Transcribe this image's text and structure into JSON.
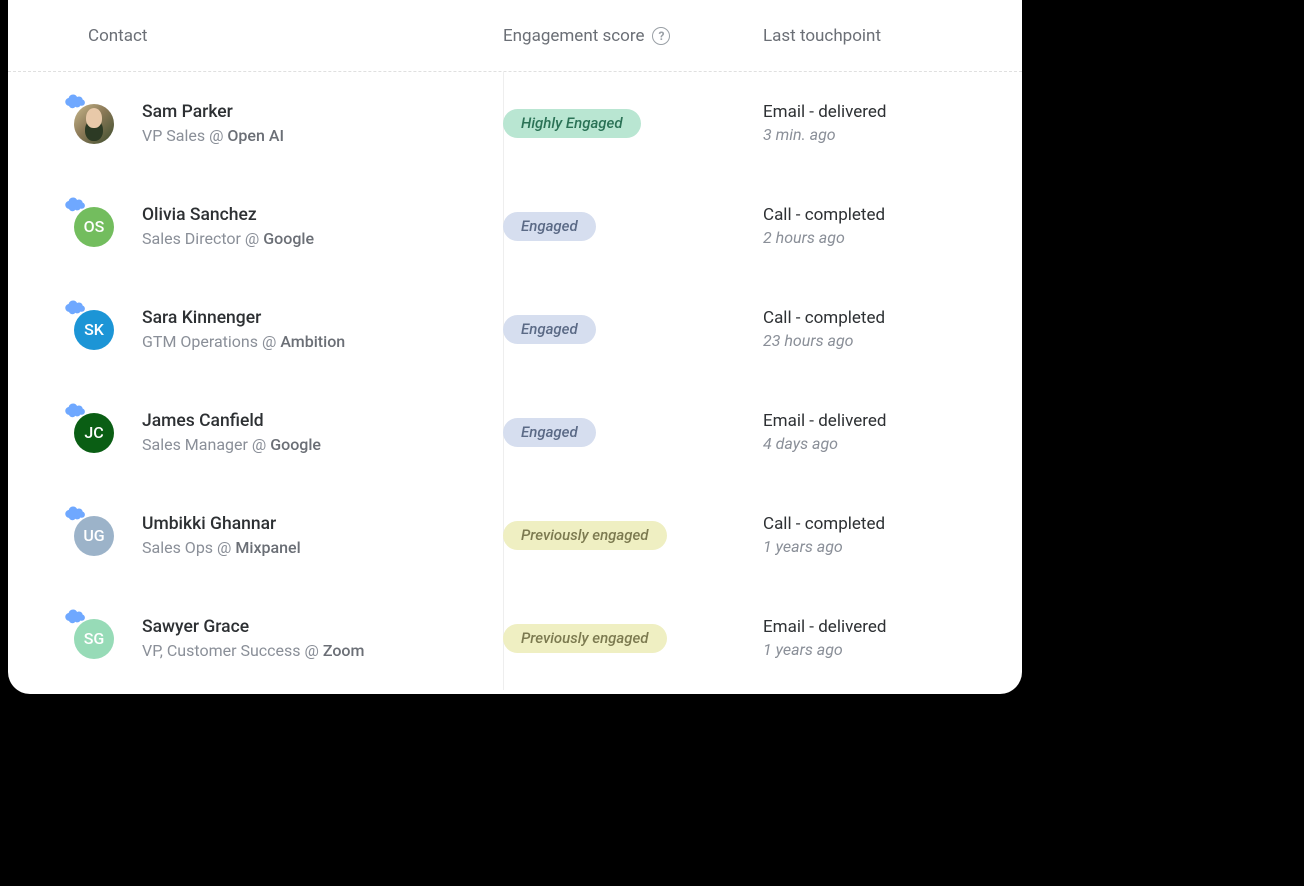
{
  "columns": {
    "contact": "Contact",
    "engagement": "Engagement score",
    "touchpoint": "Last touchpoint"
  },
  "engagement_levels": {
    "high": "Highly Engaged",
    "engaged": "Engaged",
    "prev": "Previously engaged"
  },
  "avatar_colors": {
    "os": "#73bd5e",
    "sk": "#1c95d6",
    "jc": "#0a5e14",
    "ug": "#9cb3c9",
    "sg": "#97dbb7"
  },
  "contacts": [
    {
      "name": "Sam Parker",
      "role": "VP Sales",
      "company": "Open AI",
      "initials": "",
      "avatar_type": "photo",
      "avatar_color_key": "",
      "engagement": "high",
      "touchpoint": "Email - delivered",
      "time": "3 min. ago"
    },
    {
      "name": "Olivia Sanchez",
      "role": "Sales Director",
      "company": "Google",
      "initials": "OS",
      "avatar_type": "initials",
      "avatar_color_key": "os",
      "engagement": "engaged",
      "touchpoint": "Call - completed",
      "time": "2 hours ago"
    },
    {
      "name": "Sara Kinnenger",
      "role": "GTM Operations",
      "company": "Ambition",
      "initials": "SK",
      "avatar_type": "initials",
      "avatar_color_key": "sk",
      "engagement": "engaged",
      "touchpoint": "Call - completed",
      "time": "23 hours ago"
    },
    {
      "name": "James Canfield",
      "role": "Sales Manager",
      "company": "Google",
      "initials": "JC",
      "avatar_type": "initials",
      "avatar_color_key": "jc",
      "engagement": "engaged",
      "touchpoint": "Email - delivered",
      "time": "4 days ago"
    },
    {
      "name": "Umbikki Ghannar",
      "role": "Sales Ops",
      "company": "Mixpanel",
      "initials": "UG",
      "avatar_type": "initials",
      "avatar_color_key": "ug",
      "engagement": "prev",
      "touchpoint": "Call - completed",
      "time": "1 years ago"
    },
    {
      "name": "Sawyer Grace",
      "role": "VP, Customer Success",
      "company": "Zoom",
      "initials": "SG",
      "avatar_type": "initials",
      "avatar_color_key": "sg",
      "engagement": "prev",
      "touchpoint": "Email - delivered",
      "time": "1 years ago"
    }
  ]
}
